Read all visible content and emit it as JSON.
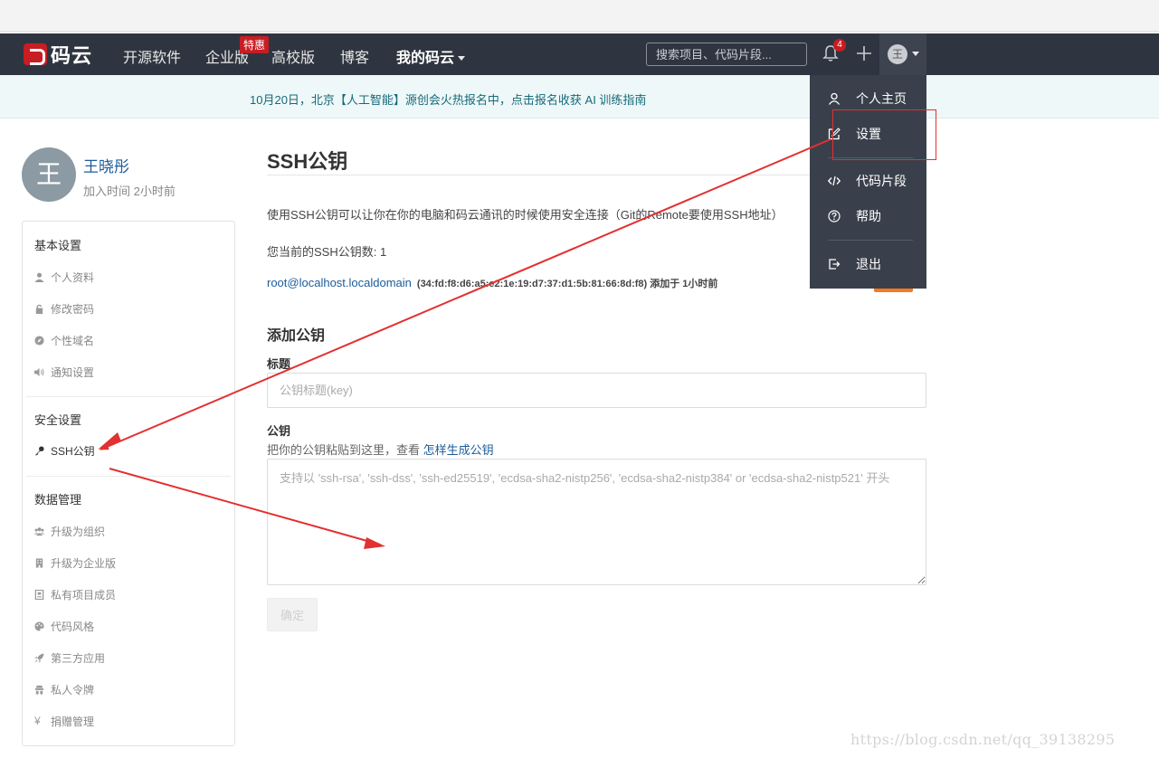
{
  "navbar": {
    "logo_text": "码云",
    "items": [
      {
        "label": "开源软件"
      },
      {
        "label": "企业版"
      },
      {
        "label": "高校版"
      },
      {
        "label": "博客"
      },
      {
        "label": "我的码云"
      }
    ],
    "enterprise_badge": "特惠",
    "search_placeholder": "搜索项目、代码片段...",
    "notification_count": "4",
    "avatar_initial": "王"
  },
  "banner": {
    "text": "10月20日，北京【人工智能】源创会火热报名中，点击报名收获 AI 训练指南"
  },
  "profile": {
    "avatar_initial": "王",
    "name": "王晓彤",
    "joined": "加入时间 2小时前"
  },
  "sidebar": {
    "groups": [
      {
        "title": "基本设置",
        "items": [
          {
            "label": "个人资料",
            "icon": "user-icon"
          },
          {
            "label": "修改密码",
            "icon": "lock-icon"
          },
          {
            "label": "个性域名",
            "icon": "compass-icon"
          },
          {
            "label": "通知设置",
            "icon": "volume-icon"
          }
        ]
      },
      {
        "title": "安全设置",
        "items": [
          {
            "label": "SSH公钥",
            "icon": "key-icon"
          }
        ]
      },
      {
        "title": "数据管理",
        "items": [
          {
            "label": "升级为组织",
            "icon": "users-icon"
          },
          {
            "label": "升级为企业版",
            "icon": "building-icon"
          },
          {
            "label": "私有项目成员",
            "icon": "badge-icon"
          },
          {
            "label": "代码风格",
            "icon": "palette-icon"
          },
          {
            "label": "第三方应用",
            "icon": "rocket-icon"
          },
          {
            "label": "私人令牌",
            "icon": "token-icon"
          },
          {
            "label": "捐赠管理",
            "icon": "yen-icon"
          }
        ]
      }
    ]
  },
  "main": {
    "title": "SSH公钥",
    "description": "使用SSH公钥可以让你在你的电脑和码云通讯的时候使用安全连接（Git的Remote要使用SSH地址）",
    "key_count": "您当前的SSH公钥数: 1",
    "key": {
      "name": "root@localhost.localdomain",
      "fingerprint": "(34:fd:f8:d6:a5:e2:1e:19:d7:37:d1:5b:81:66:8d:f8) 添加于 1小时前"
    },
    "add_title": "添加公钥",
    "title_label": "标题",
    "title_placeholder": "公钥标题(key)",
    "key_label": "公钥",
    "key_hint": "把你的公钥粘贴到这里，查看",
    "key_hint_link": "怎样生成公钥",
    "key_placeholder": "支持以 'ssh-rsa', 'ssh-dss', 'ssh-ed25519', 'ecdsa-sha2-nistp256', 'ecdsa-sha2-nistp384' or 'ecdsa-sha2-nistp521' 开头",
    "submit_label": "确定"
  },
  "dropdown": {
    "items": [
      {
        "label": "个人主页",
        "icon": "user-icon"
      },
      {
        "label": "设置",
        "icon": "edit-icon"
      },
      {
        "label": "代码片段",
        "icon": "code-icon"
      },
      {
        "label": "帮助",
        "icon": "help-icon"
      },
      {
        "label": "退出",
        "icon": "logout-icon"
      }
    ]
  },
  "annotation_color": "#e33030",
  "watermark": "https://blog.csdn.net/qq_39138295"
}
